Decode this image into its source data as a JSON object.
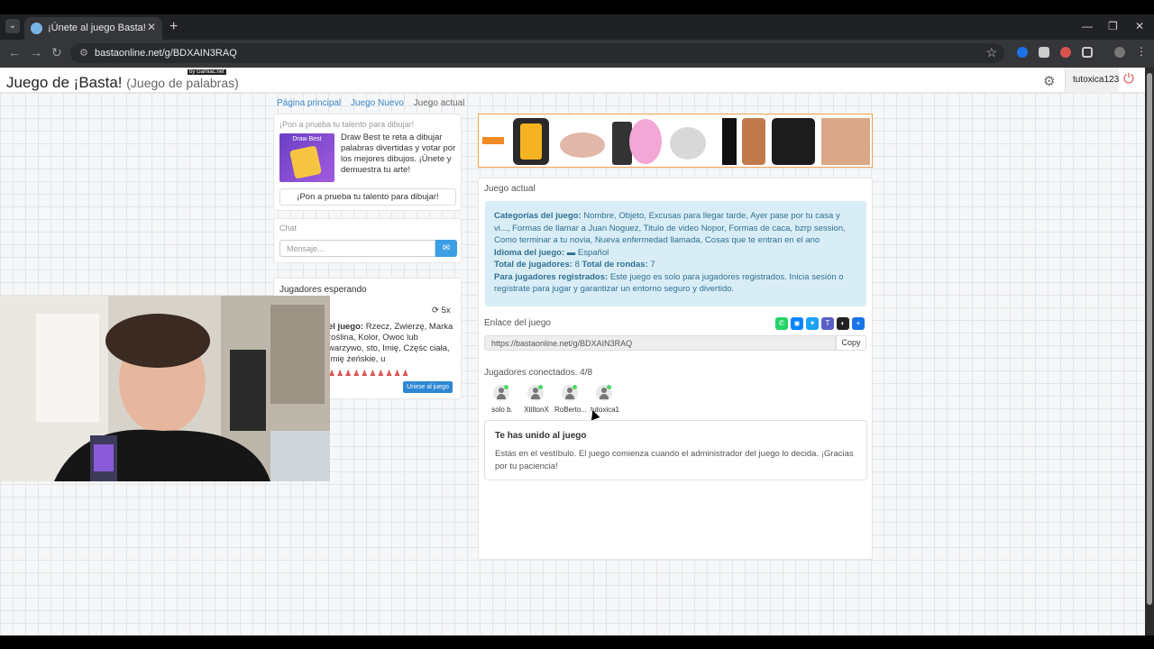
{
  "browser": {
    "tab_title": "¡Únete al juego Basta!",
    "url": "bastaonline.net/g/BDXAIN3RAQ",
    "new_tab": "+",
    "close": "✕"
  },
  "header": {
    "title": "Juego de ¡Basta!",
    "subtitle": "(Juego de palabras)",
    "badge": "by Gamiac.net",
    "username": "tutoxica123"
  },
  "breadcrumb": {
    "items": [
      "Página principal",
      "Juego Nuevo",
      "Juego actual"
    ]
  },
  "promo": {
    "title": "¡Pon a prueba tu talento para dibujar!",
    "image_label": "Draw Best",
    "text": "Draw Best te reta a dibujar palabras divertidas y votar por los mejores dibujos. ¡Únete y demuestra tu arte!",
    "button": "¡Pon a prueba tu talento para dibujar!"
  },
  "chat": {
    "title": "Chat",
    "placeholder": "Mensaje..."
  },
  "waiting": {
    "title": "Jugadores esperando",
    "rounds": "5x",
    "desc_label": "el juego:",
    "desc_text": "Rzecz, Zwierzę, Marka roślina, Kolor, Owoc lub warzywo, sto, Imię, Częśc ciała, Imię żeńskie, u",
    "slots": "♟♟♟♟♟♟♟♟♟♟",
    "join_button": "Unirse al juego"
  },
  "main": {
    "title": "Juego actual",
    "categories_label": "Categorías del juego:",
    "categories_text": "Nombre, Objeto, Excusas para llegar tarde, Ayer pase por tu casa y vi..., Formas de llamar a Juan Noguez, Titulo de video Nopor, Formas de caca, bzrp session, Como terminar a tu novia, Nueva enfermedad llamada, Cosas que te entran en el ano",
    "language_label": "Idioma del juego:",
    "language_value": "Español",
    "players_label": "Total de jugadores:",
    "players_value": "8",
    "rounds_label": "Total de rondas:",
    "rounds_value": "7",
    "registered_label": "Para jugadores registrados:",
    "registered_text": "Este juego es solo para jugadores registrados. Inicia sesión o regístrate para jugar y garantizar un entorno seguro y divertido.",
    "link_title": "Enlace del juego",
    "link_value": "https://bastaonline.net/g/BDXAIN3RAQ",
    "copy_button": "Copy",
    "connected_title": "Jugadores conectados. 4/8",
    "players": [
      "solo b.",
      "XtiltonX",
      "RoBerto...",
      "tutoxica1"
    ],
    "joined_title": "Te has unido al juego",
    "joined_text": "Estás en el vestíbulo. El juego comienza cuando el administrador del juego lo decida. ¡Gracias por tu paciencia!"
  },
  "colors": {
    "accent": "#3c9ee4",
    "info_bg": "#d9edf7",
    "info_text": "#31708f",
    "online": "#4cd964"
  }
}
